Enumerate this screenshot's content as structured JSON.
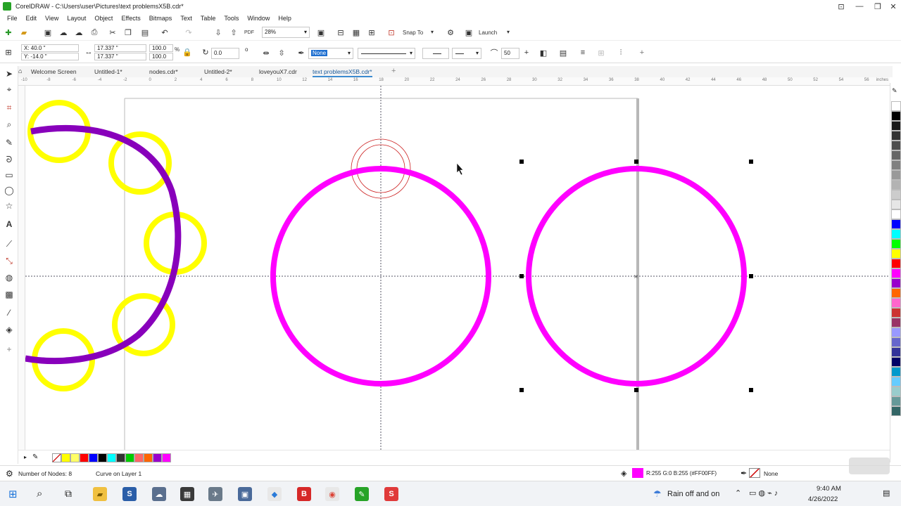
{
  "app": {
    "title": "CorelDRAW - C:\\Users\\user\\Pictures\\text problemsX5B.cdr*"
  },
  "menu": [
    "File",
    "Edit",
    "View",
    "Layout",
    "Object",
    "Effects",
    "Bitmaps",
    "Text",
    "Table",
    "Tools",
    "Window",
    "Help"
  ],
  "toolbar": {
    "zoom_value": "28%",
    "snap_label": "Snap To",
    "launch_label": "Launch"
  },
  "propertybar": {
    "x_value": "X: 40.0 \"",
    "y_value": "Y: -14.0 \"",
    "width_value": "17.337 \"",
    "height_value": "17.337 \"",
    "scale_w": "100.0",
    "scale_h": "100.0",
    "percent": "%",
    "rotation": "0.0",
    "degree": "o",
    "outline_fill": "None",
    "smoothness": "50"
  },
  "tabs": [
    "Welcome Screen",
    "Untitled-1*",
    "nodes.cdr*",
    "Untitled-2*",
    "loveyouX7.cdr",
    "text problemsX5B.cdr*"
  ],
  "active_tab_index": 5,
  "ruler": {
    "units": "inches",
    "h_labels": [
      "-10",
      "-8",
      "-6",
      "-4",
      "-2",
      "0",
      "2",
      "4",
      "6",
      "8",
      "10",
      "12",
      "14",
      "16",
      "18",
      "20",
      "22",
      "24",
      "26",
      "28",
      "30",
      "32",
      "34",
      "36",
      "38",
      "40",
      "42",
      "44",
      "46",
      "48",
      "50",
      "52",
      "54",
      "56"
    ]
  },
  "canvas": {
    "yellow_color": "#ffff00",
    "purple_color": "#8800bb",
    "magenta_color": "#ff00ff",
    "node_color": "#cc2222"
  },
  "palette": [
    "#ffffff",
    "#000000",
    "#1a1a1a",
    "#333333",
    "#4d4d4d",
    "#666666",
    "#808080",
    "#999999",
    "#b3b3b3",
    "#cccccc",
    "#e6e6e6",
    "#ffffff",
    "#0000ff",
    "#00ffff",
    "#00ff00",
    "#ffff00",
    "#ff0000",
    "#ff00ff",
    "#9900cc",
    "#ff6600",
    "#ff66cc",
    "#cc3333",
    "#993366",
    "#9999ff",
    "#6666cc",
    "#333399",
    "#000066",
    "#0099cc",
    "#66ccff",
    "#99cccc",
    "#669999",
    "#336666"
  ],
  "bottom_palette": [
    "#ffff00",
    "#ffff66",
    "#ff0000",
    "#0000ff",
    "#000000",
    "#00ffff",
    "#333333",
    "#00cc00",
    "#ff6666",
    "#ff6600",
    "#9900cc",
    "#ff00ff"
  ],
  "status": {
    "nodes": "Number of Nodes: 8",
    "curve": "Curve on Layer 1",
    "fill_info": "R:255 G:0 B:255 (#FF00FF)",
    "fill_color": "#ff00ff",
    "outline": "None"
  },
  "taskbar": {
    "weather": "Rain off and on",
    "time": "9:40 AM",
    "date": "4/26/2022"
  }
}
